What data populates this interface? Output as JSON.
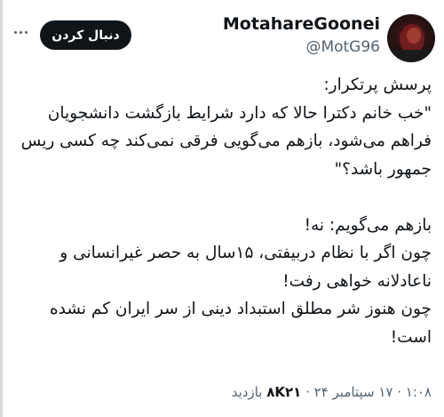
{
  "profile": {
    "display_name": "MotahareGoonei",
    "handle": "@MotG96",
    "follow_label": "دنبال کردن"
  },
  "icons": {
    "more": "more-horizontal-icon",
    "avatar": "profile-photo"
  },
  "tweet": {
    "lines": [
      "پرسش پرتکرار:",
      "\"خب خانم دکترا حالا که دارد شرایط بازگشت دانشجویان فراهم می‌شود، بازهم می‌گویی فرقی نمی‌کند چه کسی ریس جمهور باشد؟\"",
      "",
      "بازهم می‌گویم: نه!",
      "چون اگر با نظام دربیفتی، ۱۵سال به حصر غیرانسانی و ناعادلانه خواهی رفت!",
      "چون هنوز شر مطلق استبداد دینی از سر ایران کم نشده است!"
    ]
  },
  "meta": {
    "timestamp": "۱:۰۸ · ۱۷ سپتامبر ۲۴",
    "views_count": "۸K۲۱",
    "views_label": "بازدید"
  }
}
